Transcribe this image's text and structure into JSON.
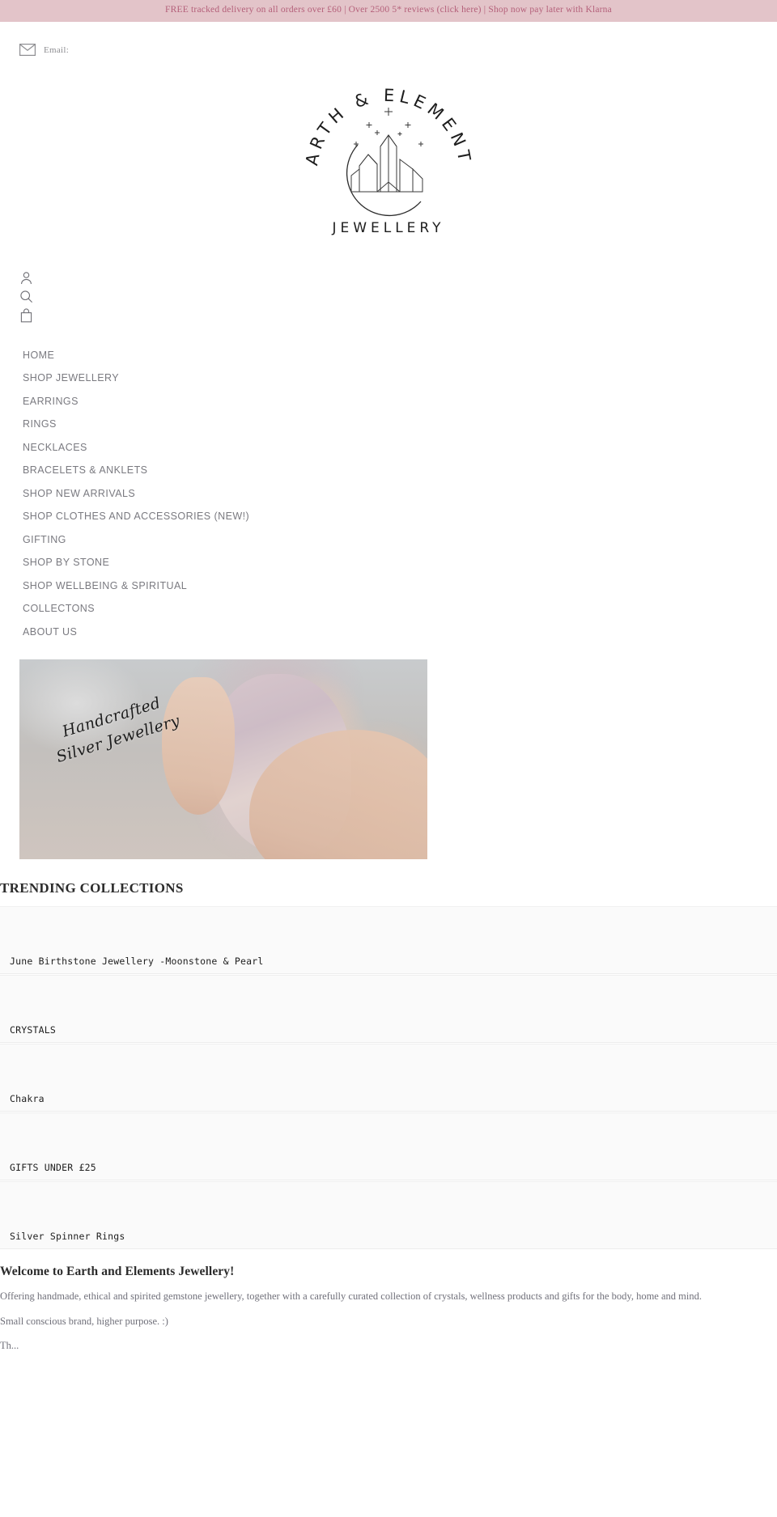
{
  "announcement": {
    "text": "FREE tracked delivery on all orders over £60 | Over 2500 5* reviews (click here) | Shop now pay later with Klarna",
    "bg_color": "#e3c4c9",
    "text_color": "#b4607a"
  },
  "topbar": {
    "email_label": "Email:",
    "email_icon": "envelope-icon"
  },
  "logo": {
    "arc_text": "EARTH & ELEMENTS",
    "bottom_text": "JEWELLERY",
    "alt": "Earth & Elements Jewellery logo with crescent moon, crystals and stars"
  },
  "utility_icons": [
    {
      "name": "account-icon",
      "label": "Account"
    },
    {
      "name": "search-icon",
      "label": "Search"
    },
    {
      "name": "cart-icon",
      "label": "Cart"
    }
  ],
  "nav": {
    "items": [
      {
        "label": "HOME"
      },
      {
        "label": "SHOP JEWELLERY"
      },
      {
        "label": "EARRINGS"
      },
      {
        "label": "RINGS"
      },
      {
        "label": "NECKLACES"
      },
      {
        "label": "BRACELETS & ANKLETS"
      },
      {
        "label": "SHOP NEW ARRIVALS"
      },
      {
        "label": "SHOP CLOTHES AND ACCESSORIES (NEW!)"
      },
      {
        "label": "GIFTING"
      },
      {
        "label": "SHOP BY STONE"
      },
      {
        "label": "SHOP WELLBEING & SPIRITUAL"
      },
      {
        "label": "COLLECTONS"
      },
      {
        "label": "ABOUT US"
      }
    ]
  },
  "hero": {
    "caption": "Handcrafted Silver Jewellery",
    "caption_line1": "Handcrafted Silver",
    "caption_line2": "Jewellery"
  },
  "trending": {
    "title": "TRENDING COLLECTIONS",
    "cards": [
      {
        "label": "June Birthstone Jewellery -Moonstone & Pearl"
      },
      {
        "label": "CRYSTALS"
      },
      {
        "label": "Chakra"
      },
      {
        "label": "GIFTS UNDER £25"
      },
      {
        "label": "Silver Spinner Rings"
      }
    ]
  },
  "welcome": {
    "heading": "Welcome to Earth and Elements Jewellery!",
    "paragraph1": "Offering handmade, ethical and spirited gemstone jewellery, together with a carefully curated collection of crystals, wellness products and gifts for the body, home and mind.",
    "paragraph2": "Small conscious brand, higher purpose. :)",
    "paragraph3": "Th..."
  }
}
